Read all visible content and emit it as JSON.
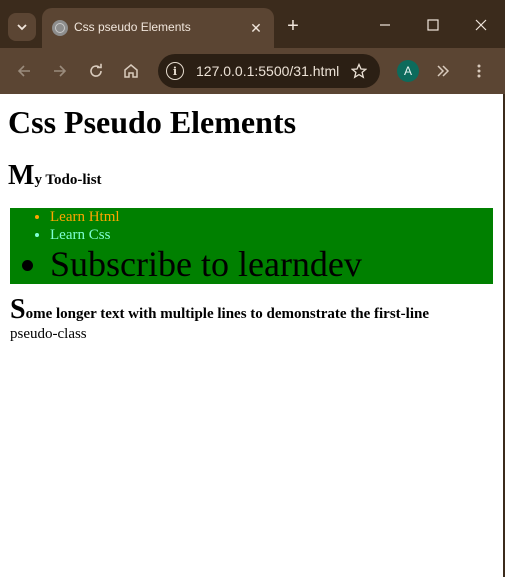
{
  "browser": {
    "tab_title": "Css pseudo Elements",
    "url": "127.0.0.1:5500/31.html",
    "profile_initial": "A",
    "new_tab_symbol": "+",
    "close_symbol": "✕",
    "icons": [
      "tab-search-icon",
      "favicon-icon",
      "close-icon",
      "plus-icon",
      "minimize-icon",
      "maximize-icon",
      "window-close-icon",
      "back-icon",
      "forward-icon",
      "reload-icon",
      "home-icon",
      "site-info-icon",
      "star-icon",
      "extensions-icon",
      "menu-icon"
    ]
  },
  "page": {
    "heading": "Css Pseudo Elements",
    "subheading_first": "M",
    "subheading_rest": "y Todo-list",
    "todo_items": [
      "Learn Html",
      "Learn Css",
      "Subscribe to learndev"
    ],
    "paragraph_first": "S",
    "paragraph_line1": "ome longer text with multiple lines to demonstrate the first-line",
    "paragraph_line2": "pseudo-class"
  },
  "colors": {
    "frame": "#3b2b1c",
    "toolbar": "#5b4533",
    "list_bg": "#008000",
    "item1": "#ffa500",
    "item2": "#7fffd4",
    "avatar": "#0d6b5c"
  }
}
